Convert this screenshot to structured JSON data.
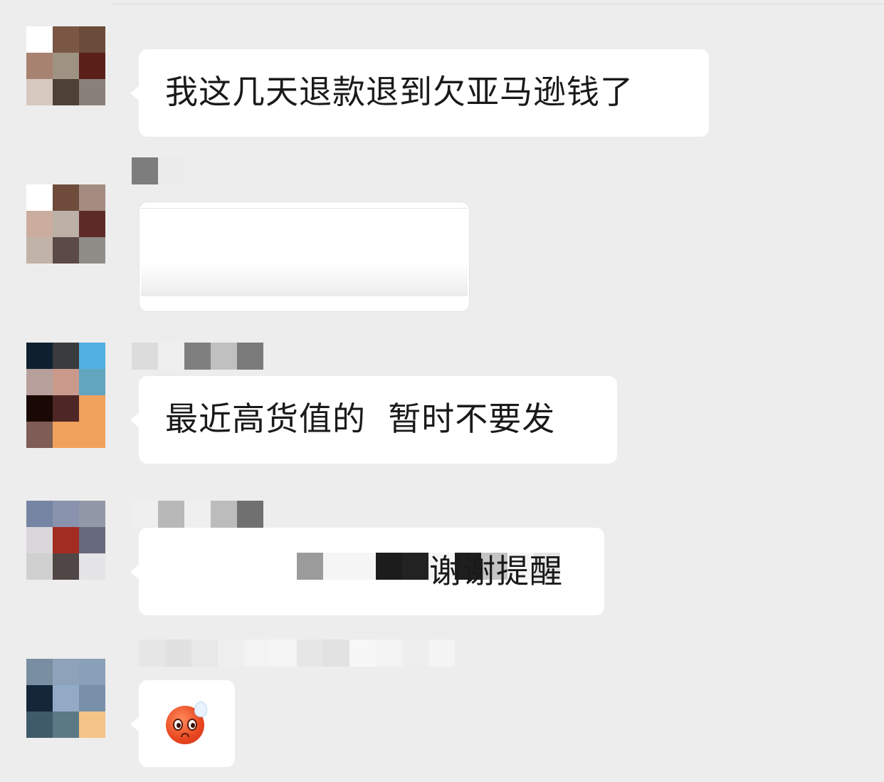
{
  "messages": [
    {
      "id": "m1",
      "avatar_colors": [
        "#ffffff",
        "#7a5744",
        "#6b4b39",
        "#a88271",
        "#9e9282",
        "#5a1f18",
        "#d6c8be",
        "#4f4037",
        "#888079"
      ],
      "sender_name_colors": [],
      "text": "我这几天退款退到欠亚马逊钱了"
    },
    {
      "id": "m2",
      "avatar_colors": [
        "#ffffff",
        "#6e4b3b",
        "#a48c80",
        "#cbad9f",
        "#bdb0a6",
        "#5e2a26",
        "#c2b3a8",
        "#5b4a47",
        "#908d89"
      ],
      "sender_name_colors": [
        "#7d7d7d",
        "#ebebeb"
      ],
      "text": ""
    },
    {
      "id": "m3",
      "avatar_colors": [
        "#0e2030",
        "#3a3b3e",
        "#53b0e2",
        "#b7a09c",
        "#c99a8c",
        "#62a5bf",
        "#1a0804",
        "#4e2626",
        "#f0a25c",
        "#7f5d56",
        "#f0a25c",
        "#f0a25c"
      ],
      "sender_name_colors": [
        "#dcdcdc",
        "#efefef",
        "#7f7f7f",
        "#c0c0c0",
        "#7a7a7a"
      ],
      "text": "最近高货值的  暂时不要发"
    },
    {
      "id": "m4",
      "avatar_colors": [
        "#7685a3",
        "#8a93ad",
        "#9398a8",
        "#dad7da",
        "#a32c22",
        "#676a7c",
        "#d0d0d0",
        "#504646",
        "#e5e4e6"
      ],
      "sender_name_colors": [
        "#efefef",
        "#b8b8b8",
        "#efefef",
        "#bcbcbc",
        "#707070"
      ],
      "redacted_colors": [
        "#9b9b9b",
        "#f5f5f5",
        "#f5f5f5",
        "#1c1c1c",
        "#222222",
        "#f5f5f5",
        "#1e1e1e",
        "#c4c4c4",
        "#f5f5f5",
        "#e4e4e4"
      ],
      "text": "谢谢提醒"
    },
    {
      "id": "m5",
      "avatar_colors": [
        "#7a8ea2",
        "#8ea3ba",
        "#8aa0b8",
        "#152639",
        "#93aac6",
        "#7890aa",
        "#3f5b6a",
        "#5b7985",
        "#f4c387"
      ],
      "sender_name_colors": [
        "#e6e6e6",
        "#e1e1e1",
        "#e8e8e8",
        "#efefef",
        "#f3f3f3",
        "#f5f5f5",
        "#e6e6e6",
        "#e2e2e2",
        "#f7f7f7",
        "#f3f3f3",
        "#eeeeee",
        "#f4f4f4"
      ],
      "emoji": "pleading-face-with-sweat"
    }
  ]
}
